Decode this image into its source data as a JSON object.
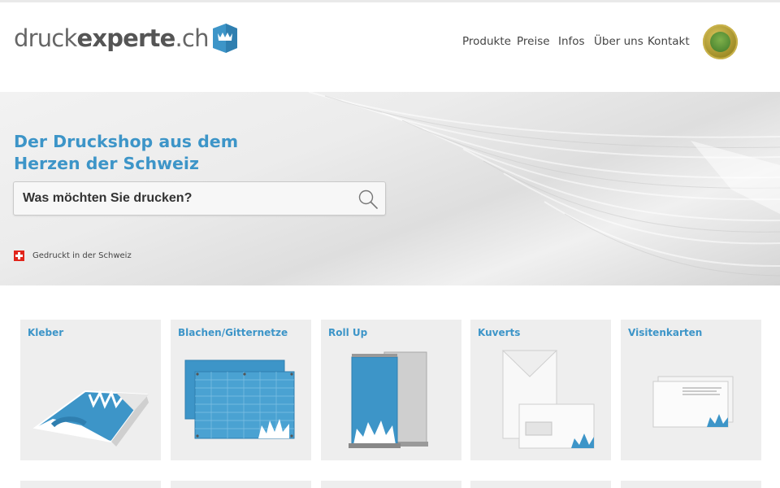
{
  "header": {
    "logo": {
      "part1": "druck",
      "part2": "experte",
      "part3": ".ch"
    },
    "nav": [
      {
        "label": "Produkte"
      },
      {
        "label": "Preise"
      },
      {
        "label": "Infos"
      },
      {
        "label": "Über uns"
      },
      {
        "label": "Kontakt"
      }
    ],
    "badge_icon": "award-badge-icon"
  },
  "hero": {
    "title_line1": "Der Druckshop aus dem",
    "title_line2": "Herzen der Schweiz",
    "search": {
      "placeholder": "Was möchten Sie drucken?",
      "value": ""
    },
    "swiss_note": "Gedruckt in der Schweiz"
  },
  "products": [
    {
      "title": "Kleber",
      "icon": "sticker-icon"
    },
    {
      "title": "Blachen/Gitternetze",
      "icon": "banner-icon"
    },
    {
      "title": "Roll Up",
      "icon": "rollup-icon"
    },
    {
      "title": "Kuverts",
      "icon": "envelope-icon"
    },
    {
      "title": "Visitenkarten",
      "icon": "business-card-icon"
    }
  ],
  "colors": {
    "accent": "#3d95c8",
    "card_bg": "#eeeeee",
    "text": "#444444"
  }
}
